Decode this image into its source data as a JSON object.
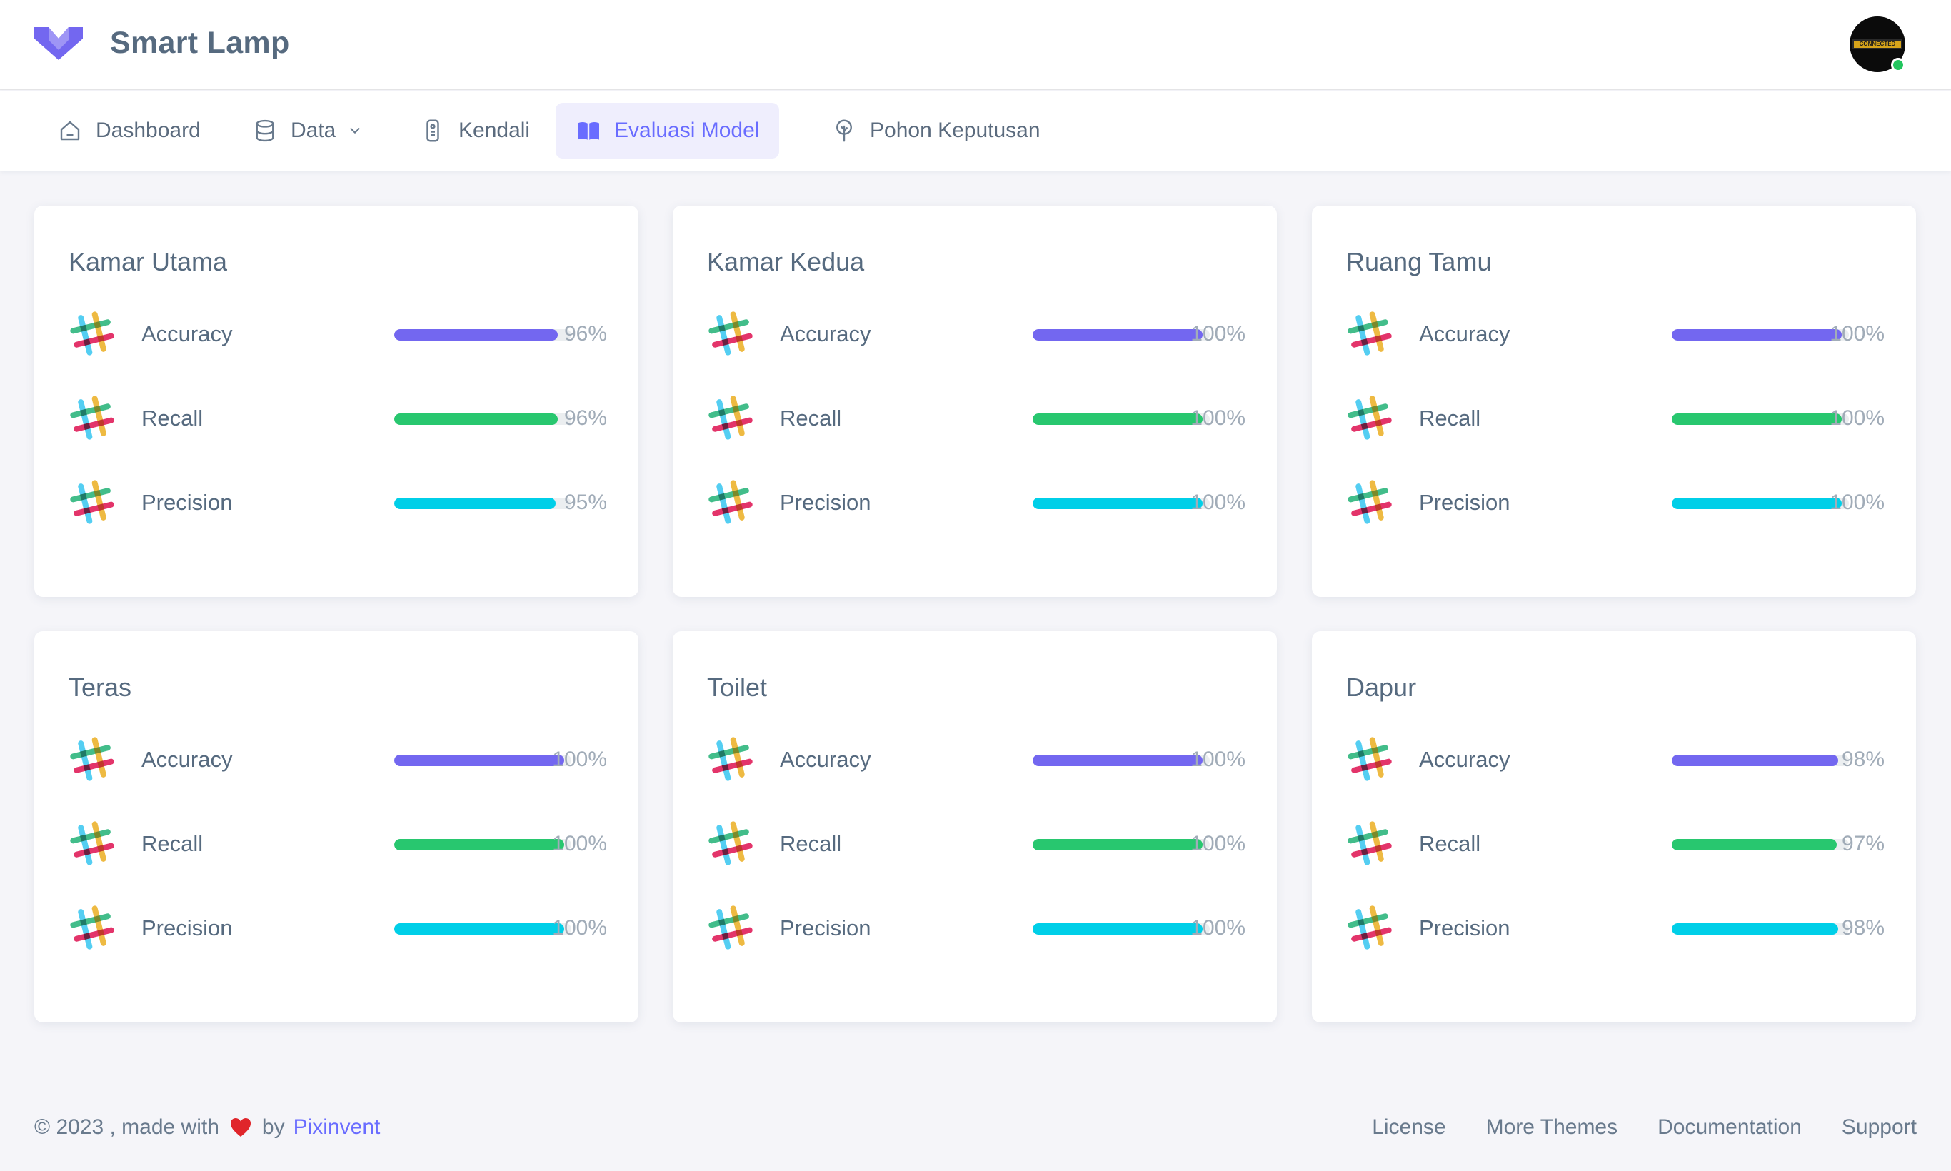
{
  "app": {
    "name": "Smart Lamp"
  },
  "avatar": {
    "band_text": "CONNECTED CRAB"
  },
  "nav": {
    "items": [
      {
        "label": "Dashboard",
        "icon": "home-icon"
      },
      {
        "label": "Data",
        "icon": "database-icon"
      },
      {
        "label": "Kendali",
        "icon": "remote-icon"
      },
      {
        "label": "Evaluasi Model",
        "icon": "book-icon",
        "active": true
      },
      {
        "label": "Pohon Keputusan",
        "icon": "tree-icon"
      }
    ]
  },
  "colors": {
    "accent": "#696cff",
    "accuracy": "#7367f0",
    "recall": "#28c76f",
    "precision": "#00cfe8"
  },
  "cards": [
    {
      "title": "Kamar Utama",
      "metrics": [
        {
          "label": "Accuracy",
          "value": "96%",
          "fill": 0.96
        },
        {
          "label": "Recall",
          "value": "96%",
          "fill": 0.96
        },
        {
          "label": "Precision",
          "value": "95%",
          "fill": 0.95
        }
      ]
    },
    {
      "title": "Kamar Kedua",
      "metrics": [
        {
          "label": "Accuracy",
          "value": "100%",
          "fill": 1.0
        },
        {
          "label": "Recall",
          "value": "100%",
          "fill": 1.0
        },
        {
          "label": "Precision",
          "value": "100%",
          "fill": 1.0
        }
      ]
    },
    {
      "title": "Ruang Tamu",
      "metrics": [
        {
          "label": "Accuracy",
          "value": "100%",
          "fill": 1.0
        },
        {
          "label": "Recall",
          "value": "100%",
          "fill": 1.0
        },
        {
          "label": "Precision",
          "value": "100%",
          "fill": 1.0
        }
      ]
    },
    {
      "title": "Teras",
      "metrics": [
        {
          "label": "Accuracy",
          "value": "100%",
          "fill": 1.0
        },
        {
          "label": "Recall",
          "value": "100%",
          "fill": 1.0
        },
        {
          "label": "Precision",
          "value": "100%",
          "fill": 1.0
        }
      ]
    },
    {
      "title": "Toilet",
      "metrics": [
        {
          "label": "Accuracy",
          "value": "100%",
          "fill": 1.0
        },
        {
          "label": "Recall",
          "value": "100%",
          "fill": 1.0
        },
        {
          "label": "Precision",
          "value": "100%",
          "fill": 1.0
        }
      ]
    },
    {
      "title": "Dapur",
      "metrics": [
        {
          "label": "Accuracy",
          "value": "98%",
          "fill": 0.98
        },
        {
          "label": "Recall",
          "value": "97%",
          "fill": 0.97
        },
        {
          "label": "Precision",
          "value": "98%",
          "fill": 0.98
        }
      ]
    }
  ],
  "footer": {
    "copyright": "© 2023 , made with",
    "by": "by",
    "brand": "Pixinvent",
    "links": [
      "License",
      "More Themes",
      "Documentation",
      "Support"
    ]
  }
}
